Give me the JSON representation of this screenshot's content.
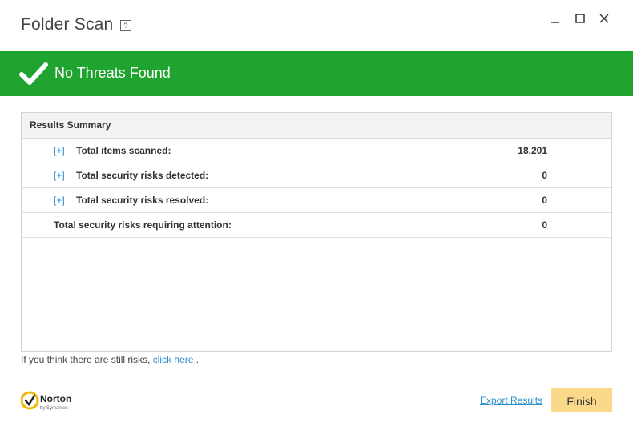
{
  "window": {
    "title": "Folder Scan",
    "help_label": "?",
    "controls": [
      "minimize-icon",
      "maximize-icon",
      "close-icon"
    ]
  },
  "banner": {
    "status": "No Threats Found",
    "icon": "checkmark-icon",
    "color": "#1ea42f"
  },
  "results": {
    "header": "Results Summary",
    "rows": [
      {
        "expander": "[+]",
        "label": "Total items scanned:",
        "value": "18,201"
      },
      {
        "expander": "[+]",
        "label": "Total security risks detected:",
        "value": "0"
      },
      {
        "expander": "[+]",
        "label": "Total security risks resolved:",
        "value": "0"
      },
      {
        "expander": "",
        "label": "Total security risks requiring attention:",
        "value": "0"
      }
    ]
  },
  "hint": {
    "prefix": "If you think there are still risks, ",
    "link": "click here",
    "suffix": "."
  },
  "logo": {
    "name": "Norton",
    "sub": "by Symantec"
  },
  "footer": {
    "export_label": "Export Results",
    "finish_label": "Finish",
    "finish_color": "#fbd98a"
  }
}
